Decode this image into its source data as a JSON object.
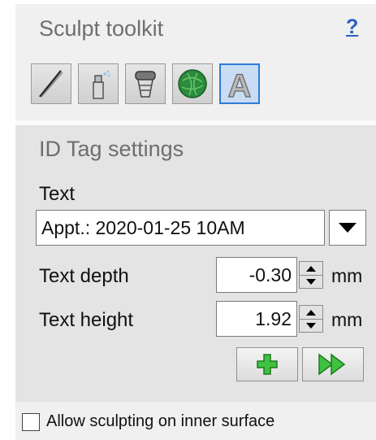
{
  "panel": {
    "title": "Sculpt toolkit",
    "help_label": "?"
  },
  "tools": [
    {
      "icon": "knife-icon",
      "active": false
    },
    {
      "icon": "spray-nozzle-icon",
      "active": false
    },
    {
      "icon": "implant-icon",
      "active": false
    },
    {
      "icon": "green-sphere-icon",
      "active": false
    },
    {
      "icon": "letter-a-icon",
      "active": true,
      "glyph": "A"
    }
  ],
  "id_tag": {
    "title": "ID Tag settings",
    "text_label": "Text",
    "text_value": "Appt.: 2020-01-25 10AM",
    "depth_label": "Text depth",
    "depth_value": "-0.30",
    "height_label": "Text height",
    "height_value": "1.92",
    "unit": "mm"
  },
  "actions": {
    "add_icon": "plus-icon",
    "apply_icon": "fast-forward-icon"
  },
  "option": {
    "checked": false,
    "label": "Allow sculpting on inner surface"
  },
  "colors": {
    "accent": "#2f7cd6",
    "help_link": "#2a5fbf",
    "action_green": "#2fb52f"
  }
}
